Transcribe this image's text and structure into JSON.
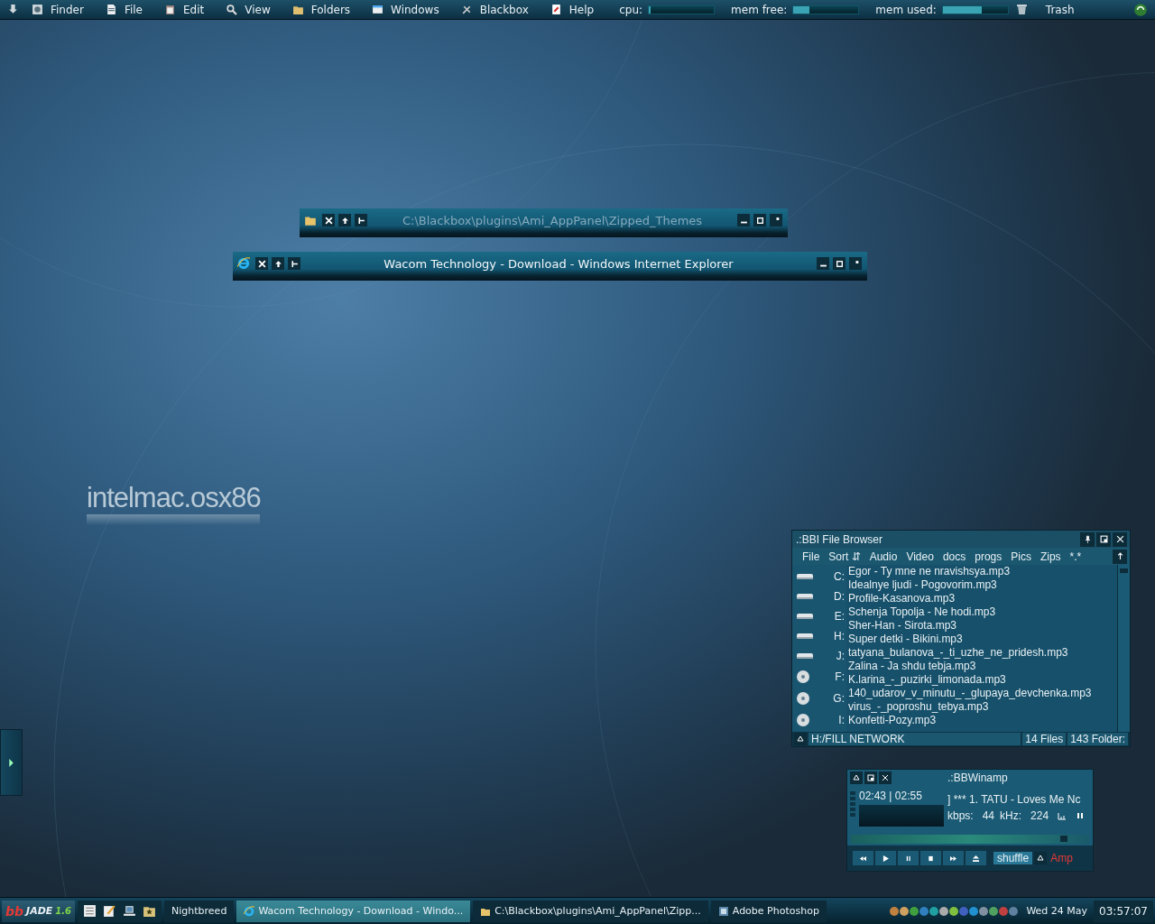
{
  "menubar": {
    "items": [
      {
        "label": "Finder"
      },
      {
        "label": "File"
      },
      {
        "label": "Edit"
      },
      {
        "label": "View"
      },
      {
        "label": "Folders"
      },
      {
        "label": "Windows"
      },
      {
        "label": "Blackbox"
      },
      {
        "label": "Help"
      }
    ],
    "meters": [
      {
        "label": "cpu:",
        "level": 0.02
      },
      {
        "label": "mem free:",
        "level": 0.25
      },
      {
        "label": "mem used:",
        "level": 0.6
      }
    ],
    "trash": "Trash"
  },
  "windows": [
    {
      "title": "C:\\Blackbox\\plugins\\Ami_AppPanel\\Zipped_Themes",
      "active": false
    },
    {
      "title": "Wacom Technology - Download - Windows Internet Explorer",
      "active": true
    }
  ],
  "logo": {
    "text": "intelmac.osx86"
  },
  "file_browser": {
    "title": ".:BBI File Browser",
    "menu": [
      "File",
      "Sort ⇵",
      "Audio",
      "Video",
      "docs",
      "progs",
      "Pics",
      "Zips",
      "*.*"
    ],
    "drives": [
      {
        "letter": "C:",
        "kind": "hdd"
      },
      {
        "letter": "D:",
        "kind": "hdd"
      },
      {
        "letter": "E:",
        "kind": "hdd"
      },
      {
        "letter": "H:",
        "kind": "hdd"
      },
      {
        "letter": "J:",
        "kind": "hdd"
      },
      {
        "letter": "F:",
        "kind": "cd"
      },
      {
        "letter": "G:",
        "kind": "cd"
      },
      {
        "letter": "I:",
        "kind": "cd"
      }
    ],
    "files": [
      "Egor - Ty mne ne nravishsya.mp3",
      "Idealnye ljudi - Pogovorim.mp3",
      "Profile-Kasanova.mp3",
      "Schenja Topolja - Ne hodi.mp3",
      "Sher-Han - Sirota.mp3",
      "Super detki -  Bikini.mp3",
      "tatyana_bulanova_-_ti_uzhe_ne_pridesh.mp3",
      "Zalina - Ja shdu tebja.mp3",
      "K.larina_-_puzirki_limonada.mp3",
      "140_udarov_v_minutu_-_glupaya_devchenka.mp3",
      "virus_-_poproshu_tebya.mp3",
      "Konfetti-Pozy.mp3"
    ],
    "path": "H:/FILL NETWORK",
    "file_count": "14 Files",
    "folder_count": "143 Folder:"
  },
  "winamp": {
    "title": ".:BBWinamp",
    "time": "02:43 | 02:55",
    "track": "] *** 1. TATU - Loves Me Nc",
    "kbps_label": "kbps:",
    "kbps": "44",
    "khz_label": "kHz:",
    "khz": "224",
    "seek": {
      "level": 0.88
    },
    "shuffle": "shuffle",
    "amp": "Amp"
  },
  "taskbar": {
    "logo": {
      "bb": "bb",
      "name": "JADE",
      "version": "1.6"
    },
    "tasks": [
      {
        "label": "Nightbreed",
        "selected": false
      },
      {
        "label": "Wacom Technology - Download - Windo...",
        "selected": true
      },
      {
        "label": "C:\\Blackbox\\plugins\\Ami_AppPanel\\Zipp...",
        "selected": false
      },
      {
        "label": "Adobe Photoshop",
        "selected": false
      }
    ],
    "date": "Wed 24 May",
    "time": "03:57:07"
  }
}
